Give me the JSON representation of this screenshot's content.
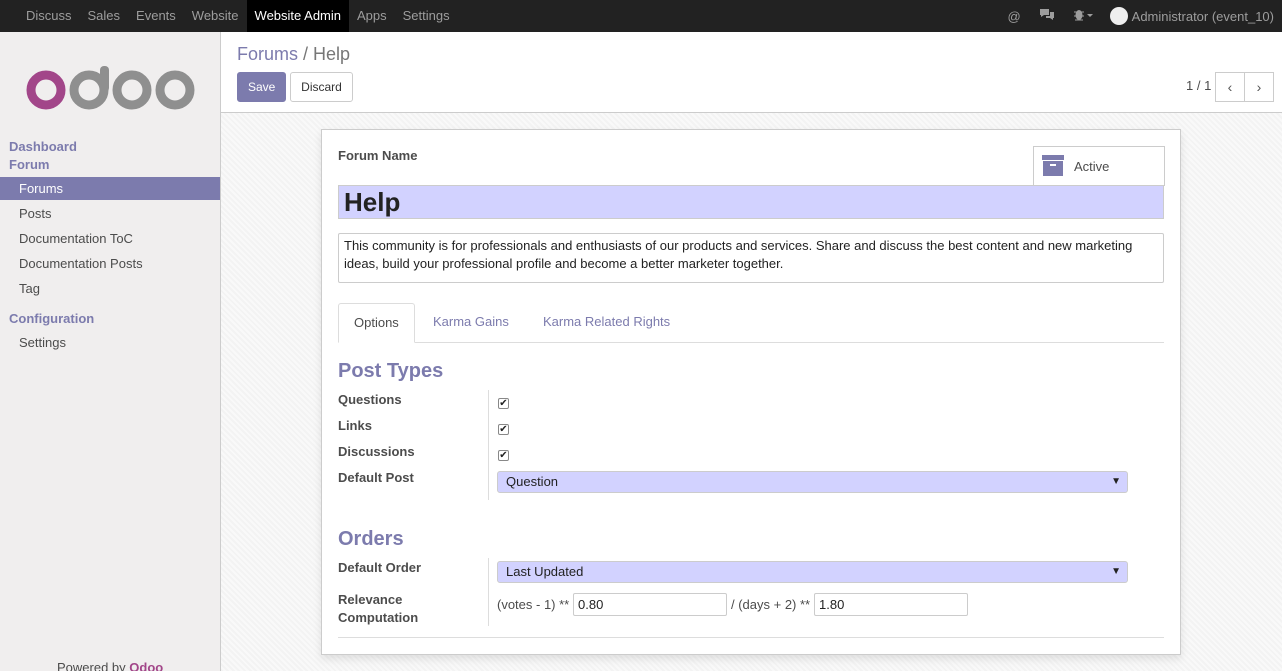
{
  "topbar": {
    "menu": [
      "Discuss",
      "Sales",
      "Events",
      "Website",
      "Website Admin",
      "Apps",
      "Settings"
    ],
    "active_index": 4,
    "icons": [
      "at-icon",
      "chat-icon",
      "bug-icon"
    ],
    "user": "Administrator (event_10)"
  },
  "sidebar": {
    "logo": "odoo",
    "dashboard": "Dashboard",
    "forum": "Forum",
    "items": [
      "Forums",
      "Posts",
      "Documentation ToC",
      "Documentation Posts",
      "Tag"
    ],
    "configuration": "Configuration",
    "config_items": [
      "Settings"
    ],
    "powered_prefix": "Powered by ",
    "powered_brand": "Odoo"
  },
  "controlpanel": {
    "breadcrumb_parent": "Forums",
    "breadcrumb_sep": " / ",
    "breadcrumb_current": " Help",
    "save_label": "Save",
    "discard_label": "Discard",
    "pager": "1 / 1",
    "prev_icon": "‹",
    "next_icon": "›"
  },
  "form": {
    "forum_name_label": "Forum Name",
    "active_label": "Active",
    "name": "Help",
    "description": "This community is for professionals and enthusiasts of our products and services. Share and discuss the best content and new marketing ideas, build your professional profile and become a better marketer together.",
    "tabs": [
      "Options",
      "Karma Gains",
      "Karma Related Rights"
    ],
    "post_types_title": "Post Types",
    "questions_label": "Questions",
    "links_label": "Links",
    "discussions_label": "Discussions",
    "default_post_label": "Default Post",
    "default_post_value": "Question",
    "orders_title": "Orders",
    "default_order_label": "Default Order",
    "default_order_value": "Last Updated",
    "relevance_label_1": "Relevance",
    "relevance_label_2": "Computation",
    "relevance_prefix": "(votes - 1) **",
    "relevance_value_1": "0.80",
    "relevance_middle": "/ (days + 2) **",
    "relevance_value_2": "1.80",
    "check_mark": "✔"
  },
  "colors": {
    "brand": "#7c7bad",
    "logo_o": "#a24689",
    "logo_grey": "#8f8f8f"
  }
}
